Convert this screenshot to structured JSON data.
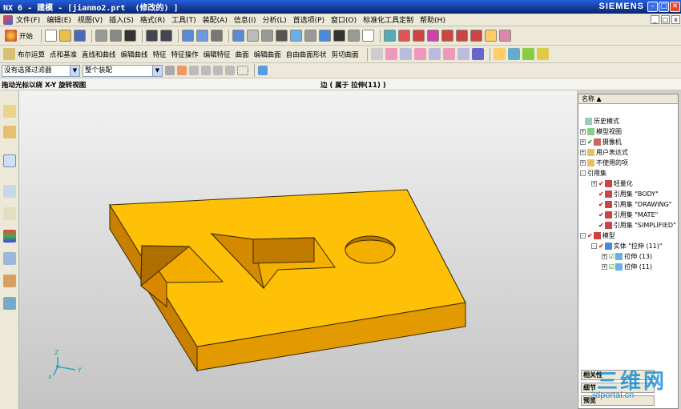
{
  "window": {
    "title": "NX 6 - 建模 - [jianmo2.prt  (修改的) ]",
    "brand": "SIEMENS",
    "min": "–",
    "max": "□",
    "close": "✕"
  },
  "menu": {
    "items": [
      "文件(F)",
      "编辑(E)",
      "视图(V)",
      "插入(S)",
      "格式(R)",
      "工具(T)",
      "装配(A)",
      "信息(I)",
      "分析(L)",
      "首选项(P)",
      "窗口(O)",
      "标准化工具定制",
      "帮助(H)"
    ]
  },
  "toolbar1": {
    "start_label": "开始",
    "icons": [
      "new-icon",
      "open-icon",
      "save-icon",
      "copy-icon",
      "paste-icon",
      "delete-icon",
      "undo-icon",
      "redo-icon",
      "measure-icon",
      "select-icon",
      "view-icon",
      "fit-icon",
      "zoom-window-icon",
      "zoom-icon",
      "rotate-icon",
      "pan-icon",
      "view-orient-icon",
      "shaded-icon",
      "render-style-icon",
      "background-color-icon",
      "wcs-icon",
      "layer-icon",
      "sketch-icon",
      "datum-icon",
      "constraint-icon",
      "edge-blend-icon",
      "chamfer-icon",
      "hole-icon",
      "feature-icon",
      "section-icon"
    ]
  },
  "toolbar2": {
    "items": [
      "布尔运算",
      "点和基准",
      "直线和曲线",
      "编辑曲线",
      "特征",
      "特征操作",
      "编辑特征",
      "曲面",
      "编辑曲面",
      "自由曲面形状",
      "剪切曲面"
    ]
  },
  "toolbar3": {
    "filter": "没有选择过滤器",
    "scope": "整个装配"
  },
  "cue": {
    "left": "拖动光标以绕 X-Y 旋转视图",
    "center": "边 ( 属于 拉伸(11) )"
  },
  "triad": {
    "x": "x",
    "y": "Y",
    "z": "Z"
  },
  "nav": {
    "header": "名称",
    "nodes": [
      {
        "label": "历史模式",
        "level": 0
      },
      {
        "label": "模型视图",
        "level": 0
      },
      {
        "label": "摄像机",
        "level": 0
      },
      {
        "label": "用户表达式",
        "level": 0
      },
      {
        "label": "不使用的项",
        "level": 0
      },
      {
        "label": "引用集",
        "level": 0
      },
      {
        "label": "轻量化",
        "level": 1
      },
      {
        "label": "引用集 \"BODY\"",
        "level": 1
      },
      {
        "label": "引用集 \"DRAWING\"",
        "level": 1
      },
      {
        "label": "引用集 \"MATE\"",
        "level": 1
      },
      {
        "label": "引用集 \"SIMPLIFIED\"",
        "level": 1
      },
      {
        "label": "模型",
        "level": 0
      },
      {
        "label": "实体 \"拉伸 (11)\"",
        "level": 1
      },
      {
        "label": "拉伸 (13)",
        "level": 2
      },
      {
        "label": "拉伸 (11)",
        "level": 2
      }
    ],
    "tabs": [
      "相关性",
      "细节",
      "预览"
    ]
  },
  "watermark": {
    "big": "三维网",
    "small": "3dportal.cn"
  },
  "colors": {
    "part_top": "#ffc107",
    "part_side": "#d98d00",
    "part_edge": "#3a2a00",
    "accent": "#0a246a"
  }
}
